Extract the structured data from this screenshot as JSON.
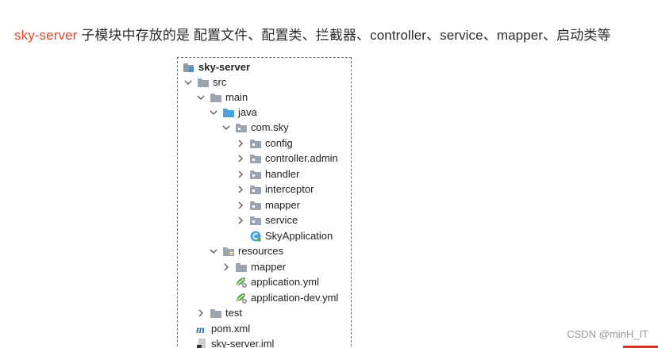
{
  "headline": {
    "accent": "sky-server",
    "rest": " 子模块中存放的是 配置文件、配置类、拦截器、controller、service、mapper、启动类等"
  },
  "tree": {
    "root": "sky-server",
    "src": "src",
    "main": "main",
    "java": "java",
    "package": "com.sky",
    "config": "config",
    "controller_admin": "controller.admin",
    "handler": "handler",
    "interceptor": "interceptor",
    "mapper": "mapper",
    "service": "service",
    "sky_application": "SkyApplication",
    "resources": "resources",
    "resources_mapper": "mapper",
    "application_yml": "application.yml",
    "application_dev_yml": "application-dev.yml",
    "test": "test",
    "pom": "pom.xml",
    "iml": "sky-server.iml"
  },
  "watermark": "CSDN @minH_IT",
  "colors": {
    "accent": "#e0462b",
    "folder": "#9aa5b1",
    "source_folder": "#4aa3df",
    "spring_green": "#6aa84f"
  },
  "icons": {
    "expanded": "chevron-down-icon",
    "collapsed": "chevron-right-icon",
    "folder": "folder-icon",
    "package": "package-icon",
    "module": "module-icon",
    "java_class": "class-icon",
    "yml": "spring-config-icon",
    "maven": "maven-icon",
    "iml": "iml-file-icon"
  }
}
